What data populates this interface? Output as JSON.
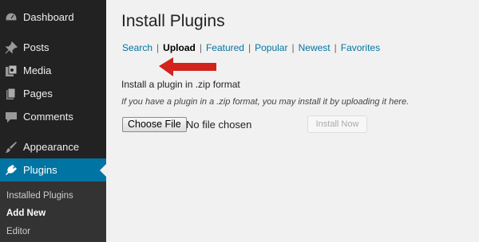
{
  "sidebar": {
    "items": [
      {
        "label": "Dashboard",
        "icon": "dashboard-icon"
      },
      {
        "label": "Posts",
        "icon": "pin-icon"
      },
      {
        "label": "Media",
        "icon": "media-icon"
      },
      {
        "label": "Pages",
        "icon": "pages-icon"
      },
      {
        "label": "Comments",
        "icon": "comments-icon"
      },
      {
        "label": "Appearance",
        "icon": "brush-icon"
      },
      {
        "label": "Plugins",
        "icon": "plugin-icon",
        "active": true
      }
    ],
    "submenu": [
      {
        "label": "Installed Plugins"
      },
      {
        "label": "Add New",
        "current": true
      },
      {
        "label": "Editor"
      }
    ],
    "colors": {
      "background": "#222222",
      "active": "#0074a2",
      "submenu_bg": "#333333"
    }
  },
  "main": {
    "title": "Install Plugins",
    "tabs": [
      {
        "label": "Search"
      },
      {
        "label": "Upload",
        "current": true
      },
      {
        "label": "Featured"
      },
      {
        "label": "Popular"
      },
      {
        "label": "Newest"
      },
      {
        "label": "Favorites"
      }
    ],
    "tab_separator": "|",
    "upload_heading": "Install a plugin in .zip format",
    "upload_help": "If you have a plugin in a .zip format, you may install it by uploading it here.",
    "file_button": "Choose File",
    "file_status": "No file chosen",
    "install_button": "Install Now",
    "colors": {
      "link": "#0074a2",
      "annotation_arrow": "#d2231d"
    }
  }
}
